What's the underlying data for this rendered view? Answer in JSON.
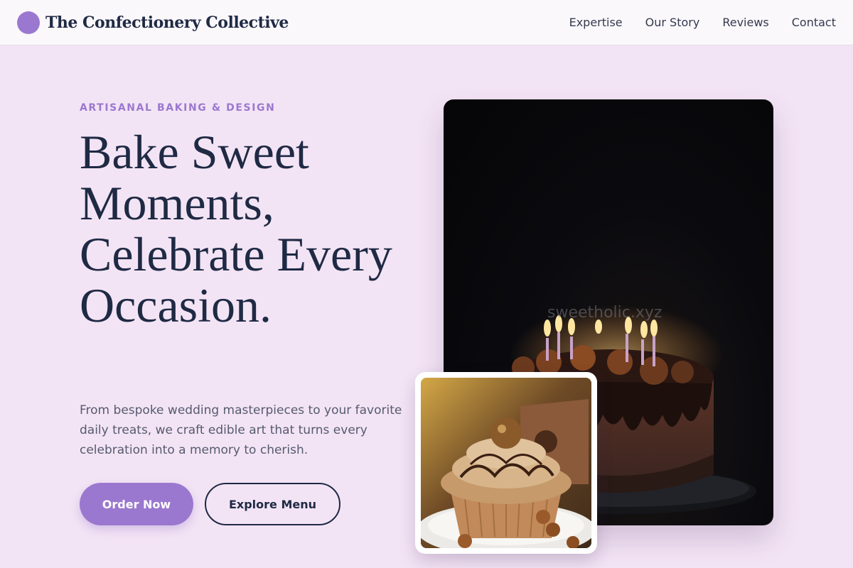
{
  "header": {
    "brand": "The Confectionery Collective",
    "nav": [
      "Expertise",
      "Our Story",
      "Reviews",
      "Contact"
    ]
  },
  "hero": {
    "eyebrow": "ARTISANAL BAKING & DESIGN",
    "headline": "Bake Sweet Moments, Celebrate Every Occasion.",
    "description": "From bespoke wedding masterpieces to your favorite daily treats, we craft edible art that turns every celebration into a memory to cherish.",
    "primary_button": "Order Now",
    "secondary_button": "Explore Menu"
  },
  "images": {
    "main_watermark": "sweetholic.xyz",
    "main_photo_icon": "chocolate-cake-with-candles",
    "inset_photo_icon": "hazelnut-cupcake"
  },
  "colors": {
    "accent": "#9b78cf",
    "background": "#f3e4f5",
    "text": "#1f2a44"
  }
}
